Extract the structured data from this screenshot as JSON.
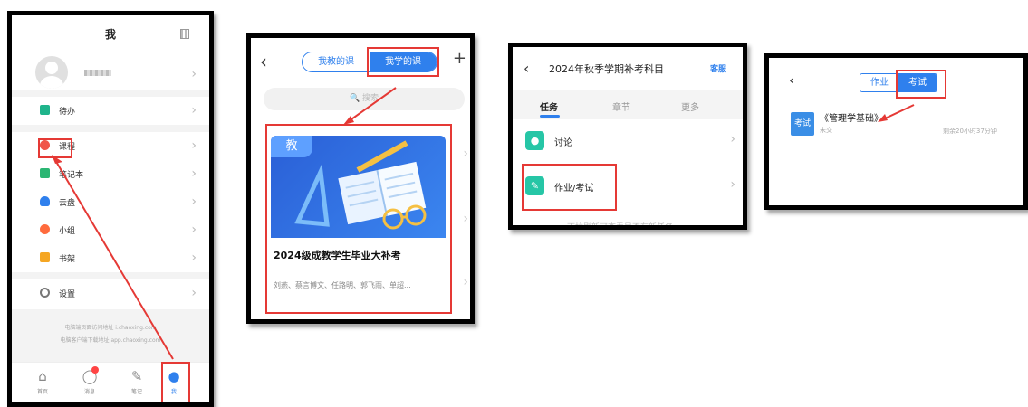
{
  "colors": {
    "accent": "#2f80ed",
    "highlight": "#e53935",
    "teal": "#26c6a6"
  },
  "panel_me": {
    "title": "我",
    "menu": [
      {
        "label": "待办",
        "icon": "todo-icon",
        "color": "#1fb48b"
      },
      {
        "label": "课程",
        "icon": "course-icon",
        "color": "#f0554a"
      },
      {
        "label": "笔记本",
        "icon": "notebook-icon",
        "color": "#2bb673"
      },
      {
        "label": "云盘",
        "icon": "cloud-icon",
        "color": "#2f80ed"
      },
      {
        "label": "小组",
        "icon": "group-icon",
        "color": "#ff6b3d"
      },
      {
        "label": "书架",
        "icon": "bookshelf-icon",
        "color": "#f5a623"
      }
    ],
    "settings": "设置",
    "footer_lines": [
      "电脑端页面访问地址 i.chaoxing.com",
      "电脑客户端下载地址 app.chaoxing.com"
    ],
    "tabs": [
      {
        "label": "首页",
        "icon": "home-icon"
      },
      {
        "label": "消息",
        "icon": "message-icon"
      },
      {
        "label": "笔记",
        "icon": "note-icon"
      },
      {
        "label": "我",
        "icon": "person-icon"
      }
    ]
  },
  "panel_courses": {
    "seg_taught": "我教的课",
    "seg_learning": "我学的课",
    "plus": "+",
    "search_placeholder": "搜索",
    "card_tag": "教",
    "course_title": "2024级成教学生毕业大补考",
    "course_teachers": "刘燕、蔡言博文、任路明、郭飞雨、单超..."
  },
  "panel_tasks": {
    "title": "2024年秋季学期补考科目",
    "service": "客服",
    "tabs": [
      "任务",
      "章节",
      "更多"
    ],
    "rows": [
      {
        "label": "讨论",
        "icon": "discussion-icon"
      },
      {
        "label": "作业/考试",
        "icon": "homework-icon"
      }
    ],
    "cut_note": "下拉刷新可查看是否有新任务"
  },
  "panel_exam": {
    "seg_homework": "作业",
    "seg_exam": "考试",
    "item_tag": "考试",
    "item_name": "《管理学基础》",
    "item_status": "未交",
    "item_time": "剩余20小时37分钟"
  }
}
